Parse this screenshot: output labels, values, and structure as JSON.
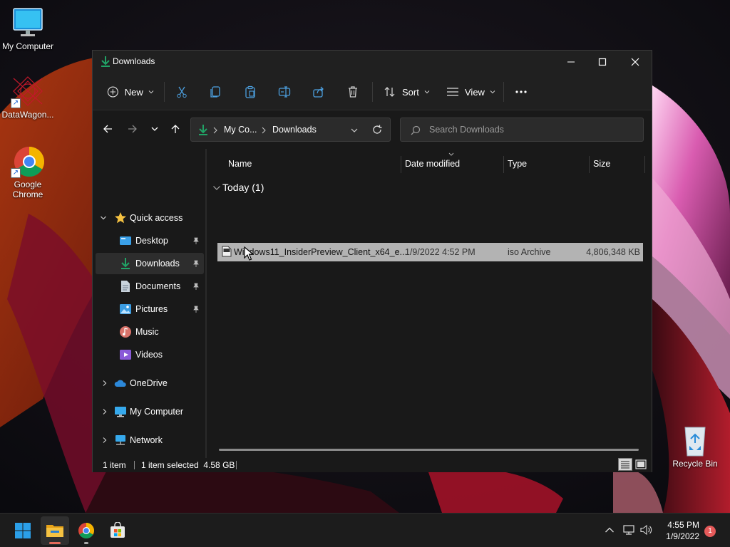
{
  "desktop": {
    "icons": [
      {
        "label": "My Computer"
      },
      {
        "label": "DataWagon..."
      },
      {
        "label": "Google Chrome"
      },
      {
        "label": "Recycle Bin"
      }
    ]
  },
  "window": {
    "title": "Downloads",
    "controls": {
      "minimize": "minimize",
      "maximize": "maximize",
      "close": "close"
    }
  },
  "commandbar": {
    "new_label": "New",
    "sort_label": "Sort",
    "view_label": "View"
  },
  "address": {
    "crumbs": [
      "My Co...",
      "Downloads"
    ],
    "search_placeholder": "Search Downloads"
  },
  "nav": {
    "quick_access": "Quick access",
    "items": [
      {
        "label": "Desktop",
        "pinned": true
      },
      {
        "label": "Downloads",
        "pinned": true,
        "selected": true
      },
      {
        "label": "Documents",
        "pinned": true
      },
      {
        "label": "Pictures",
        "pinned": true
      },
      {
        "label": "Music",
        "pinned": false
      },
      {
        "label": "Videos",
        "pinned": false
      }
    ],
    "roots": [
      {
        "label": "OneDrive"
      },
      {
        "label": "My Computer"
      },
      {
        "label": "Network"
      }
    ]
  },
  "list": {
    "columns": {
      "name": "Name",
      "date": "Date modified",
      "type": "Type",
      "size": "Size"
    },
    "group_header": "Today (1)",
    "files": [
      {
        "name": "Windows11_InsiderPreview_Client_x64_e...",
        "date": "1/9/2022 4:52 PM",
        "type": "iso Archive",
        "size": "4,806,348 KB"
      }
    ]
  },
  "status": {
    "count": "1 item",
    "selection": "1 item selected  4.58 GB"
  },
  "taskbar": {
    "time": "4:55 PM",
    "date": "1/9/2022",
    "notifications": "1"
  },
  "colors": {
    "accent_green": "#21a366",
    "selection_gray": "#b3b3b3",
    "folder_yellow": "#f5c242",
    "badge_red": "#e55a5a"
  }
}
